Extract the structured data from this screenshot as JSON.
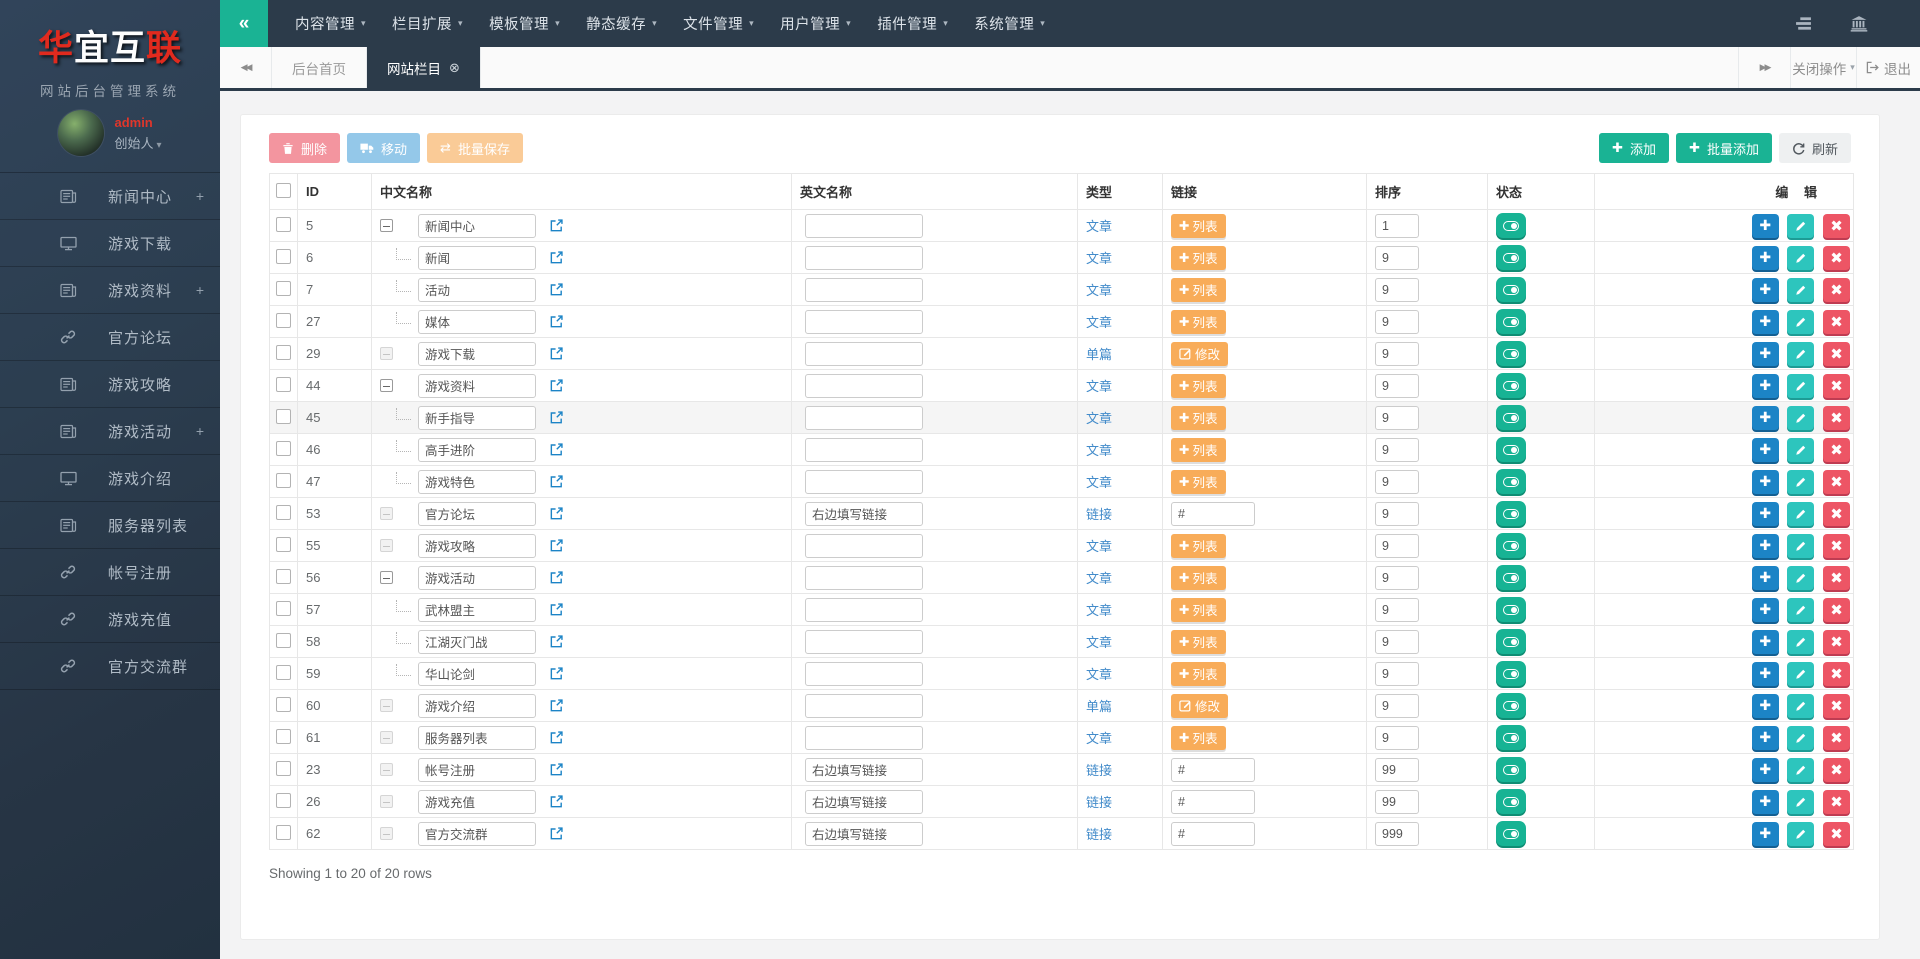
{
  "brand": {
    "logo": {
      "c1": "华",
      "c2": "宜",
      "c3": "互",
      "c4": "联"
    },
    "subtitle": "网站后台管理系统",
    "username": "admin",
    "role": "创始人"
  },
  "navbar": {
    "collapse_icon": "«",
    "caret_icon": "▾",
    "menus": [
      {
        "key": "content-mgmt",
        "label": "内容管理"
      },
      {
        "key": "column-extend",
        "label": "栏目扩展"
      },
      {
        "key": "template-mgmt",
        "label": "模板管理"
      },
      {
        "key": "static-cache",
        "label": "静态缓存"
      },
      {
        "key": "file-mgmt",
        "label": "文件管理"
      },
      {
        "key": "user-mgmt",
        "label": "用户管理"
      },
      {
        "key": "plugin-mgmt",
        "label": "插件管理"
      },
      {
        "key": "system-mgmt",
        "label": "系统管理"
      }
    ],
    "right_icons": [
      {
        "name": "tasks-icon"
      },
      {
        "name": "bank-icon"
      }
    ]
  },
  "tabbar": {
    "back_icon": "◀◀",
    "forward_icon": "▶▶",
    "tab_close_icon": "⊗",
    "tabs": [
      {
        "key": "home",
        "label": "后台首页",
        "active": false,
        "closable": false
      },
      {
        "key": "site-columns",
        "label": "网站栏目",
        "active": true,
        "closable": true
      }
    ],
    "close_ops_label": "关闭操作",
    "logout_label": "退出"
  },
  "sidebar": {
    "expand_icon": "+",
    "items": [
      {
        "key": "news-center",
        "label": "新闻中心",
        "icon": "newspaper-icon",
        "expandable": true
      },
      {
        "key": "game-download",
        "label": "游戏下载",
        "icon": "desktop-icon",
        "expandable": false
      },
      {
        "key": "game-data",
        "label": "游戏资料",
        "icon": "newspaper-icon",
        "expandable": true
      },
      {
        "key": "official-forum",
        "label": "官方论坛",
        "icon": "link-icon",
        "expandable": false
      },
      {
        "key": "game-guide",
        "label": "游戏攻略",
        "icon": "newspaper-icon",
        "expandable": false
      },
      {
        "key": "game-activity",
        "label": "游戏活动",
        "icon": "newspaper-icon",
        "expandable": true
      },
      {
        "key": "game-intro",
        "label": "游戏介绍",
        "icon": "desktop-icon",
        "expandable": false
      },
      {
        "key": "server-list",
        "label": "服务器列表",
        "icon": "newspaper-icon",
        "expandable": false
      },
      {
        "key": "account-register",
        "label": "帐号注册",
        "icon": "link-icon",
        "expandable": false
      },
      {
        "key": "game-recharge",
        "label": "游戏充值",
        "icon": "link-icon",
        "expandable": false
      },
      {
        "key": "official-group",
        "label": "官方交流群",
        "icon": "link-icon",
        "expandable": false
      }
    ]
  },
  "toolbar": {
    "delete_label": "删除",
    "move_label": "移动",
    "batch_save_label": "批量保存",
    "add_label": "添加",
    "batch_add_label": "批量添加",
    "refresh_label": "刷新"
  },
  "table": {
    "headers": {
      "id": "ID",
      "cname": "中文名称",
      "ename": "英文名称",
      "type": "类型",
      "link": "链接",
      "sort": "排序",
      "status": "状态",
      "edit": "编 辑"
    },
    "link_labels": {
      "list": "列表",
      "modify": "修改"
    },
    "rows": [
      {
        "id": "5",
        "tree": "parent",
        "name": "新闻中心",
        "ename": "",
        "type": "文章",
        "link": "list",
        "sort": "1",
        "highlight": false
      },
      {
        "id": "6",
        "tree": "child",
        "name": "新闻",
        "ename": "",
        "type": "文章",
        "link": "list",
        "sort": "9",
        "highlight": false
      },
      {
        "id": "7",
        "tree": "child",
        "name": "活动",
        "ename": "",
        "type": "文章",
        "link": "list",
        "sort": "9",
        "highlight": false
      },
      {
        "id": "27",
        "tree": "child",
        "name": "媒体",
        "ename": "",
        "type": "文章",
        "link": "list",
        "sort": "9",
        "highlight": false
      },
      {
        "id": "29",
        "tree": "leaf",
        "name": "游戏下载",
        "ename": "",
        "type": "单篇",
        "link": "modify",
        "sort": "9",
        "highlight": false
      },
      {
        "id": "44",
        "tree": "parent",
        "name": "游戏资料",
        "ename": "",
        "type": "文章",
        "link": "list",
        "sort": "9",
        "highlight": false
      },
      {
        "id": "45",
        "tree": "child",
        "name": "新手指导",
        "ename": "",
        "type": "文章",
        "link": "list",
        "sort": "9",
        "highlight": true
      },
      {
        "id": "46",
        "tree": "child",
        "name": "高手进阶",
        "ename": "",
        "type": "文章",
        "link": "list",
        "sort": "9",
        "highlight": false
      },
      {
        "id": "47",
        "tree": "child",
        "name": "游戏特色",
        "ename": "",
        "type": "文章",
        "link": "list",
        "sort": "9",
        "highlight": false
      },
      {
        "id": "53",
        "tree": "leaf",
        "name": "官方论坛",
        "ename": "右边填写链接",
        "type": "链接",
        "link": "url",
        "link_value": "#",
        "sort": "9",
        "highlight": false
      },
      {
        "id": "55",
        "tree": "leaf",
        "name": "游戏攻略",
        "ename": "",
        "type": "文章",
        "link": "list",
        "sort": "9",
        "highlight": false
      },
      {
        "id": "56",
        "tree": "parent",
        "name": "游戏活动",
        "ename": "",
        "type": "文章",
        "link": "list",
        "sort": "9",
        "highlight": false
      },
      {
        "id": "57",
        "tree": "child",
        "name": "武林盟主",
        "ename": "",
        "type": "文章",
        "link": "list",
        "sort": "9",
        "highlight": false
      },
      {
        "id": "58",
        "tree": "child",
        "name": "江湖灭门战",
        "ename": "",
        "type": "文章",
        "link": "list",
        "sort": "9",
        "highlight": false
      },
      {
        "id": "59",
        "tree": "child",
        "name": "华山论剑",
        "ename": "",
        "type": "文章",
        "link": "list",
        "sort": "9",
        "highlight": false
      },
      {
        "id": "60",
        "tree": "leaf",
        "name": "游戏介绍",
        "ename": "",
        "type": "单篇",
        "link": "modify",
        "sort": "9",
        "highlight": false
      },
      {
        "id": "61",
        "tree": "leaf",
        "name": "服务器列表",
        "ename": "",
        "type": "文章",
        "link": "list",
        "sort": "9",
        "highlight": false
      },
      {
        "id": "23",
        "tree": "leaf",
        "name": "帐号注册",
        "ename": "右边填写链接",
        "type": "链接",
        "link": "url",
        "link_value": "#",
        "sort": "99",
        "highlight": false
      },
      {
        "id": "26",
        "tree": "leaf",
        "name": "游戏充值",
        "ename": "右边填写链接",
        "type": "链接",
        "link": "url",
        "link_value": "#",
        "sort": "99",
        "highlight": false
      },
      {
        "id": "62",
        "tree": "leaf",
        "name": "官方交流群",
        "ename": "右边填写链接",
        "type": "链接",
        "link": "url",
        "link_value": "#",
        "sort": "999",
        "highlight": false
      }
    ],
    "footer": "Showing 1 to 20 of 20 rows"
  },
  "colors": {
    "primary": "#1ab394",
    "navbar": "#2c3b4a",
    "blue": "#1c84c6",
    "info": "#2dc5bd",
    "danger": "#ed5565",
    "warning": "#f8ac59",
    "link_text": "#428bca",
    "logo_red": "#e02a1e"
  }
}
